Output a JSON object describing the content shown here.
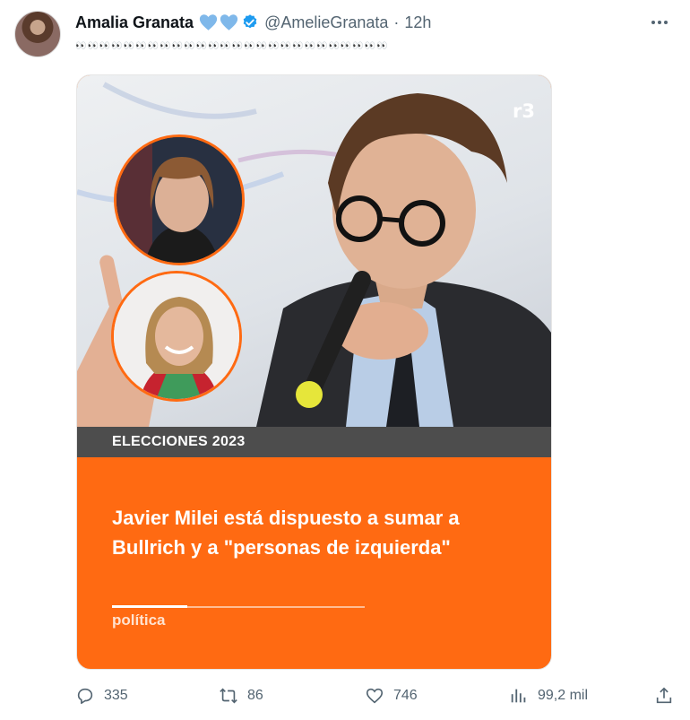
{
  "tweet": {
    "display_name": "Amalia Granata",
    "handle": "@AmelieGranata",
    "separator": "·",
    "time": "12h",
    "name_emojis": [
      "blue-heart",
      "blue-heart"
    ],
    "verified_icon": "verified-badge-icon",
    "text": "👀👀👀👀👀👀👀👀👀👀👀👀👀👀👀👀👀👀👀👀👀👀👀👀👀👀",
    "more_icon": "more-horizontal-icon"
  },
  "card": {
    "logo": "r3",
    "tag": "ELECCIONES 2023",
    "headline": "Javier Milei está dispuesto a sumar a Bullrich y a \"personas de izquierda\"",
    "section": "política",
    "background_color": "#ff6a12",
    "tagbar_color": "#4d4d4d"
  },
  "actions": {
    "reply": {
      "icon": "reply-icon",
      "count": "335"
    },
    "retweet": {
      "icon": "retweet-icon",
      "count": "86"
    },
    "like": {
      "icon": "heart-icon",
      "count": "746"
    },
    "views": {
      "icon": "views-icon",
      "count": "99,2 mil"
    },
    "share": {
      "icon": "share-icon"
    }
  },
  "colors": {
    "text_primary": "#0f1419",
    "text_secondary": "#536471",
    "accent_blue": "#1d9bf0"
  }
}
